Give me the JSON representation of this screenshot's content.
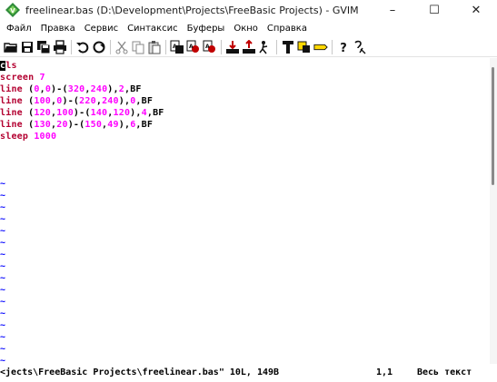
{
  "window": {
    "title": "freelinear.bas (D:\\Development\\Projects\\FreeBasic Projects) - GVIM",
    "minimize": "–",
    "maximize": "☐",
    "close": "✕"
  },
  "menu": {
    "items": [
      "Файл",
      "Правка",
      "Сервис",
      "Синтаксис",
      "Буферы",
      "Окно",
      "Справка"
    ]
  },
  "toolbar": {
    "icons": [
      "open-icon",
      "save-icon",
      "save-all-icon",
      "print-icon",
      "undo-icon",
      "redo-icon",
      "cut-icon",
      "copy-icon",
      "paste-icon",
      "replace-icon",
      "find-next-icon",
      "find-prev-icon",
      "load-session-icon",
      "save-session-icon",
      "run-script-icon",
      "make-icon",
      "shell-icon",
      "tag-jump-icon",
      "help-icon",
      "find-help-icon"
    ]
  },
  "editor": {
    "lines": [
      [
        {
          "t": "c",
          "c": "cursor"
        },
        {
          "t": "ls",
          "c": "kw"
        }
      ],
      [
        {
          "t": "screen ",
          "c": "kw"
        },
        {
          "t": "7",
          "c": "num"
        }
      ],
      [
        {
          "t": "line ",
          "c": "kw"
        },
        {
          "t": "(",
          "c": "plain"
        },
        {
          "t": "0",
          "c": "num"
        },
        {
          "t": ",",
          "c": "plain"
        },
        {
          "t": "0",
          "c": "num"
        },
        {
          "t": ")-(",
          "c": "plain"
        },
        {
          "t": "320",
          "c": "num"
        },
        {
          "t": ",",
          "c": "plain"
        },
        {
          "t": "240",
          "c": "num"
        },
        {
          "t": "),",
          "c": "plain"
        },
        {
          "t": "2",
          "c": "num"
        },
        {
          "t": ",BF",
          "c": "plain"
        }
      ],
      [
        {
          "t": "line ",
          "c": "kw"
        },
        {
          "t": "(",
          "c": "plain"
        },
        {
          "t": "100",
          "c": "num"
        },
        {
          "t": ",",
          "c": "plain"
        },
        {
          "t": "0",
          "c": "num"
        },
        {
          "t": ")-(",
          "c": "plain"
        },
        {
          "t": "220",
          "c": "num"
        },
        {
          "t": ",",
          "c": "plain"
        },
        {
          "t": "240",
          "c": "num"
        },
        {
          "t": "),",
          "c": "plain"
        },
        {
          "t": "0",
          "c": "num"
        },
        {
          "t": ",BF",
          "c": "plain"
        }
      ],
      [
        {
          "t": "line ",
          "c": "kw"
        },
        {
          "t": "(",
          "c": "plain"
        },
        {
          "t": "120",
          "c": "num"
        },
        {
          "t": ",",
          "c": "plain"
        },
        {
          "t": "100",
          "c": "num"
        },
        {
          "t": ")-(",
          "c": "plain"
        },
        {
          "t": "140",
          "c": "num"
        },
        {
          "t": ",",
          "c": "plain"
        },
        {
          "t": "120",
          "c": "num"
        },
        {
          "t": "),",
          "c": "plain"
        },
        {
          "t": "4",
          "c": "num"
        },
        {
          "t": ",BF",
          "c": "plain"
        }
      ],
      [
        {
          "t": "line ",
          "c": "kw"
        },
        {
          "t": "(",
          "c": "plain"
        },
        {
          "t": "130",
          "c": "num"
        },
        {
          "t": ",",
          "c": "plain"
        },
        {
          "t": "20",
          "c": "num"
        },
        {
          "t": ")-(",
          "c": "plain"
        },
        {
          "t": "150",
          "c": "num"
        },
        {
          "t": ",",
          "c": "plain"
        },
        {
          "t": "49",
          "c": "num"
        },
        {
          "t": "),",
          "c": "plain"
        },
        {
          "t": "6",
          "c": "num"
        },
        {
          "t": ",BF",
          "c": "plain"
        }
      ],
      [
        {
          "t": "sleep ",
          "c": "kw"
        },
        {
          "t": "1000",
          "c": "num"
        }
      ],
      [],
      [],
      [],
      [
        {
          "t": "~",
          "c": "tilde"
        }
      ],
      [
        {
          "t": "~",
          "c": "tilde"
        }
      ],
      [
        {
          "t": "~",
          "c": "tilde"
        }
      ],
      [
        {
          "t": "~",
          "c": "tilde"
        }
      ],
      [
        {
          "t": "~",
          "c": "tilde"
        }
      ],
      [
        {
          "t": "~",
          "c": "tilde"
        }
      ],
      [
        {
          "t": "~",
          "c": "tilde"
        }
      ],
      [
        {
          "t": "~",
          "c": "tilde"
        }
      ],
      [
        {
          "t": "~",
          "c": "tilde"
        }
      ],
      [
        {
          "t": "~",
          "c": "tilde"
        }
      ],
      [
        {
          "t": "~",
          "c": "tilde"
        }
      ],
      [
        {
          "t": "~",
          "c": "tilde"
        }
      ],
      [
        {
          "t": "~",
          "c": "tilde"
        }
      ],
      [
        {
          "t": "~",
          "c": "tilde"
        }
      ],
      [
        {
          "t": "~",
          "c": "tilde"
        }
      ],
      [
        {
          "t": "~",
          "c": "tilde"
        }
      ]
    ]
  },
  "status": {
    "file": "<jects\\FreeBasic Projects\\freelinear.bas\" 10L, 149B",
    "position": "1,1",
    "scroll": "Весь текст"
  },
  "colors": {
    "keyword": "#b30030",
    "number": "#ff00ff",
    "tilde": "#0000ff"
  }
}
